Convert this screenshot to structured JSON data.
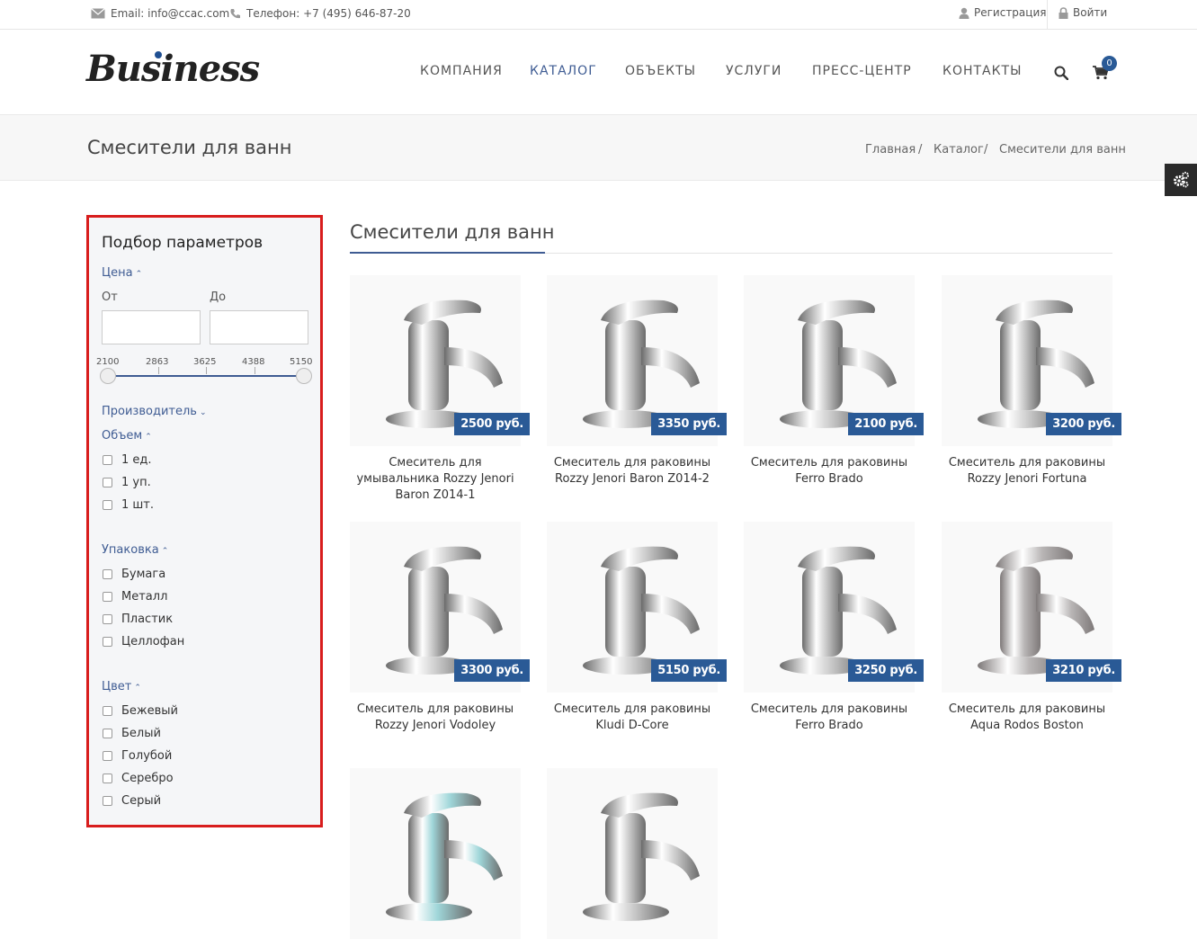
{
  "topbar": {
    "email": "Email: info@ccac.com",
    "phone": "Телефон: +7 (495) 646-87-20",
    "register": "Регистрация",
    "login": "Войти"
  },
  "header": {
    "logo": "Business",
    "nav": [
      "КОМПАНИЯ",
      "КАТАЛОГ",
      "ОБЪЕКТЫ",
      "УСЛУГИ",
      "ПРЕСС-ЦЕНТР",
      "КОНТАКТЫ"
    ],
    "active_nav": "КАТАЛОГ",
    "cart_count": "0"
  },
  "page": {
    "title": "Смесители для ванн",
    "breadcrumbs": [
      "Главная",
      "Каталог",
      "Смесители для ванн"
    ]
  },
  "filter": {
    "title": "Подбор параметров",
    "price": {
      "label": "Цена",
      "from_label": "От",
      "to_label": "До",
      "from_value": "",
      "to_value": "",
      "ticks": [
        "2100",
        "2863",
        "3625",
        "4388",
        "5150"
      ]
    },
    "manufacturer": "Производитель",
    "volume": {
      "label": "Объем",
      "options": [
        "1 ед.",
        "1 уп.",
        "1 шт."
      ]
    },
    "packaging": {
      "label": "Упаковка",
      "options": [
        "Бумага",
        "Металл",
        "Пластик",
        "Целлофан"
      ]
    },
    "color": {
      "label": "Цвет",
      "options": [
        "Бежевый",
        "Белый",
        "Голубой",
        "Серебро",
        "Серый"
      ]
    }
  },
  "catalog": {
    "title": "Смесители для ванн",
    "products": [
      {
        "name": "Смеситель для умывальника Rozzy Jenori Baron Z014-1",
        "price": "2500 руб."
      },
      {
        "name": "Смеситель для раковины Rozzy Jenori Baron Z014-2",
        "price": "3350 руб."
      },
      {
        "name": "Смеситель для раковины Ferro Brado",
        "price": "2100 руб."
      },
      {
        "name": "Смеситель для раковины Rozzy Jenori Fortuna",
        "price": "3200 руб."
      },
      {
        "name": "Смеситель для раковины Rozzy Jenori Vodoley",
        "price": "3300 руб."
      },
      {
        "name": "Смеситель для раковины Kludi D-Core",
        "price": "5150 руб."
      },
      {
        "name": "Смеситель для раковины Ferro Brado",
        "price": "3250 руб."
      },
      {
        "name": "Смеситель для раковины Aqua Rodos Boston",
        "price": "3210 руб."
      },
      {
        "name": "",
        "price": ""
      },
      {
        "name": "",
        "price": ""
      }
    ]
  },
  "colors": {
    "accent": "#3f5c93",
    "badge": "#2a5a96",
    "filter_border": "#d81d1d"
  }
}
